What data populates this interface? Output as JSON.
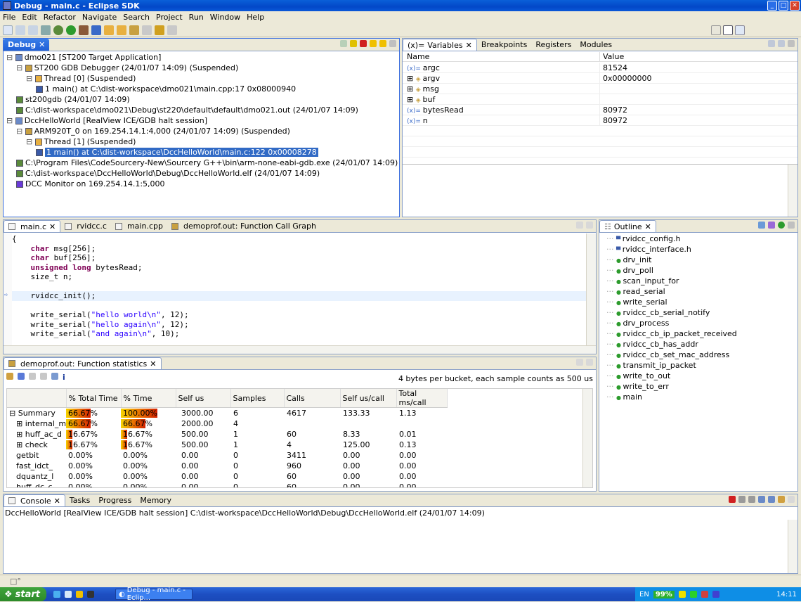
{
  "window": {
    "title": "Debug - main.c - Eclipse SDK"
  },
  "menu": [
    "File",
    "Edit",
    "Refactor",
    "Navigate",
    "Search",
    "Project",
    "Run",
    "Window",
    "Help"
  ],
  "debug_view": {
    "tab": "Debug",
    "tree": [
      {
        "indent": 0,
        "text": "dmo021 [ST200 Target Application]",
        "icon": "launch-icon"
      },
      {
        "indent": 1,
        "text": "ST200 GDB Debugger (24/01/07 14:09) (Suspended)",
        "icon": "debugger-icon"
      },
      {
        "indent": 2,
        "text": "Thread [0] (Suspended)",
        "icon": "thread-icon"
      },
      {
        "indent": 3,
        "text": "1 main() at C:\\dist-workspace\\dmo021\\main.cpp:17 0x08000940",
        "icon": "stackframe-icon"
      },
      {
        "indent": 1,
        "text": "st200gdb (24/01/07 14:09)",
        "icon": "process-icon"
      },
      {
        "indent": 1,
        "text": "C:\\dist-workspace\\dmo021\\Debug\\st220\\default\\default\\dmo021.out (24/01/07 14:09)",
        "icon": "process-icon"
      },
      {
        "indent": 0,
        "text": "DccHelloWorld [RealView ICE/GDB halt session]",
        "icon": "launch-icon"
      },
      {
        "indent": 1,
        "text": "ARM920T_0 on 169.254.14.1:4,000 (24/01/07 14:09) (Suspended)",
        "icon": "debugger-icon"
      },
      {
        "indent": 2,
        "text": "Thread [1] (Suspended)",
        "icon": "thread-icon"
      },
      {
        "indent": 3,
        "text": "1 main() at C:\\dist-workspace\\DccHelloWorld\\main.c:122 0x00008278",
        "icon": "stackframe-icon",
        "selected": true
      },
      {
        "indent": 1,
        "text": "C:\\Program Files\\CodeSourcery-New\\Sourcery G++\\bin\\arm-none-eabi-gdb.exe (24/01/07 14:09)",
        "icon": "process-icon"
      },
      {
        "indent": 1,
        "text": "C:\\dist-workspace\\DccHelloWorld\\Debug\\DccHelloWorld.elf (24/01/07 14:09)",
        "icon": "process-icon"
      },
      {
        "indent": 1,
        "text": "DCC Monitor on 169.254.14.1:5,000",
        "icon": "monitor-icon"
      }
    ]
  },
  "variables_view": {
    "tabs": [
      "Variables",
      "Breakpoints",
      "Registers",
      "Modules"
    ],
    "columns": [
      "Name",
      "Value"
    ],
    "rows": [
      {
        "name": "argc",
        "value": "81524",
        "expand": ""
      },
      {
        "name": "argv",
        "value": "0x00000000",
        "expand": "⊞"
      },
      {
        "name": "msg",
        "value": "",
        "expand": "⊞"
      },
      {
        "name": "buf",
        "value": "",
        "expand": "⊞"
      },
      {
        "name": "bytesRead",
        "value": "80972",
        "expand": ""
      },
      {
        "name": "n",
        "value": "80972",
        "expand": ""
      }
    ]
  },
  "editor": {
    "tabs": [
      "main.c",
      "rvidcc.c",
      "main.cpp",
      "demoprof.out: Function Call Graph"
    ],
    "lines": [
      {
        "parts": [
          {
            "t": "{",
            "c": ""
          }
        ]
      },
      {
        "parts": [
          {
            "t": "    ",
            "c": ""
          },
          {
            "t": "char",
            "c": "kw"
          },
          {
            "t": " msg[256];",
            "c": ""
          }
        ]
      },
      {
        "parts": [
          {
            "t": "    ",
            "c": ""
          },
          {
            "t": "char",
            "c": "kw"
          },
          {
            "t": " buf[256];",
            "c": ""
          }
        ]
      },
      {
        "parts": [
          {
            "t": "    ",
            "c": ""
          },
          {
            "t": "unsigned long",
            "c": "kw"
          },
          {
            "t": " bytesRead;",
            "c": ""
          }
        ]
      },
      {
        "parts": [
          {
            "t": "    size_t n;",
            "c": ""
          }
        ]
      },
      {
        "parts": [
          {
            "t": "",
            "c": ""
          }
        ]
      },
      {
        "parts": [
          {
            "t": "    rvidcc_init();",
            "c": ""
          }
        ],
        "current": true
      },
      {
        "parts": [
          {
            "t": "",
            "c": ""
          }
        ]
      },
      {
        "parts": [
          {
            "t": "    write_serial(",
            "c": ""
          },
          {
            "t": "\"hello world\\n\"",
            "c": "str"
          },
          {
            "t": ", 12);",
            "c": ""
          }
        ]
      },
      {
        "parts": [
          {
            "t": "    write_serial(",
            "c": ""
          },
          {
            "t": "\"hello again\\n\"",
            "c": "str"
          },
          {
            "t": ", 12);",
            "c": ""
          }
        ]
      },
      {
        "parts": [
          {
            "t": "    write_serial(",
            "c": ""
          },
          {
            "t": "\"and again\\n\"",
            "c": "str"
          },
          {
            "t": ", 10);",
            "c": ""
          }
        ]
      }
    ]
  },
  "outline": {
    "tab": "Outline",
    "items": [
      {
        "label": "rvidcc_config.h",
        "type": "include"
      },
      {
        "label": "rvidcc_interface.h",
        "type": "include"
      },
      {
        "label": "drv_init",
        "type": "fn"
      },
      {
        "label": "drv_poll",
        "type": "fn"
      },
      {
        "label": "scan_input_for",
        "type": "fn"
      },
      {
        "label": "read_serial",
        "type": "fn"
      },
      {
        "label": "write_serial",
        "type": "fn"
      },
      {
        "label": "rvidcc_cb_serial_notify",
        "type": "fn"
      },
      {
        "label": "drv_process",
        "type": "fn"
      },
      {
        "label": "rvidcc_cb_ip_packet_received",
        "type": "fn"
      },
      {
        "label": "rvidcc_cb_has_addr",
        "type": "fn"
      },
      {
        "label": "rvidcc_cb_set_mac_address",
        "type": "fn"
      },
      {
        "label": "transmit_ip_packet",
        "type": "fn"
      },
      {
        "label": "write_to_out",
        "type": "fn"
      },
      {
        "label": "write_to_err",
        "type": "fn"
      },
      {
        "label": "main",
        "type": "fn"
      }
    ]
  },
  "stats": {
    "tab": "demoprof.out: Function statistics",
    "info": "4 bytes per bucket, each sample counts as 500 us",
    "columns": [
      "",
      "% Total Time",
      "% Time",
      "Self us",
      "Samples",
      "Calls",
      "Self us/call",
      "Total ms/call"
    ],
    "rows": [
      {
        "expand": "⊟",
        "name": "Summary",
        "total": "66.67%",
        "total_v": 0.6667,
        "time": "100.00%",
        "time_v": 1.0,
        "self": "3000.00",
        "samples": "6",
        "calls": "4617",
        "selfcall": "133.33",
        "totalcall": "1.13",
        "indent": 0
      },
      {
        "expand": "⊞",
        "name": "internal_m",
        "total": "66.67%",
        "total_v": 0.6667,
        "time": "66.67%",
        "time_v": 0.6667,
        "self": "2000.00",
        "samples": "4",
        "calls": "",
        "selfcall": "",
        "totalcall": "",
        "indent": 1
      },
      {
        "expand": "⊞",
        "name": "huff_ac_d",
        "total": "16.67%",
        "total_v": 0.1667,
        "time": "16.67%",
        "time_v": 0.1667,
        "self": "500.00",
        "samples": "1",
        "calls": "60",
        "selfcall": "8.33",
        "totalcall": "0.01",
        "indent": 1
      },
      {
        "expand": "⊞",
        "name": "check",
        "total": "16.67%",
        "total_v": 0.1667,
        "time": "16.67%",
        "time_v": 0.1667,
        "self": "500.00",
        "samples": "1",
        "calls": "4",
        "selfcall": "125.00",
        "totalcall": "0.13",
        "indent": 1
      },
      {
        "expand": "",
        "name": "getbit",
        "total": "0.00%",
        "total_v": 0,
        "time": "0.00%",
        "time_v": 0,
        "self": "0.00",
        "samples": "0",
        "calls": "3411",
        "selfcall": "0.00",
        "totalcall": "0.00",
        "indent": 1
      },
      {
        "expand": "",
        "name": "fast_idct_",
        "total": "0.00%",
        "total_v": 0,
        "time": "0.00%",
        "time_v": 0,
        "self": "0.00",
        "samples": "0",
        "calls": "960",
        "selfcall": "0.00",
        "totalcall": "0.00",
        "indent": 1
      },
      {
        "expand": "",
        "name": "dquantz_l",
        "total": "0.00%",
        "total_v": 0,
        "time": "0.00%",
        "time_v": 0,
        "self": "0.00",
        "samples": "0",
        "calls": "60",
        "selfcall": "0.00",
        "totalcall": "0.00",
        "indent": 1
      },
      {
        "expand": "",
        "name": "huff_dc_c",
        "total": "0.00%",
        "total_v": 0,
        "time": "0.00%",
        "time_v": 0,
        "self": "0.00",
        "samples": "0",
        "calls": "60",
        "selfcall": "0.00",
        "totalcall": "0.00",
        "indent": 1
      }
    ]
  },
  "console": {
    "tabs": [
      "Console",
      "Tasks",
      "Progress",
      "Memory"
    ],
    "text": "DccHelloWorld [RealView ICE/GDB halt session] C:\\dist-workspace\\DccHelloWorld\\Debug\\DccHelloWorld.elf (24/01/07 14:09)"
  },
  "taskbar": {
    "start": "start",
    "task": "Debug - main.c - Eclip...",
    "lang": "EN",
    "battery": "99%",
    "clock": "14:11"
  },
  "colors": {
    "selection": "#316ac5",
    "current_line": "#e8f2fe",
    "keyword": "#7f0055",
    "string": "#2a00ff"
  }
}
